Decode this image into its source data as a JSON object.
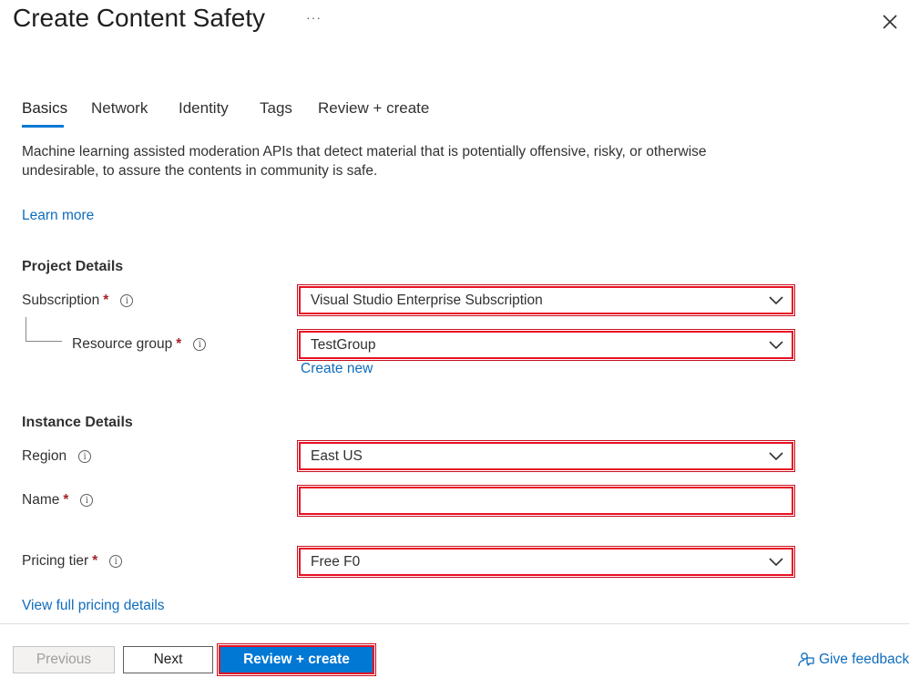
{
  "header": {
    "title": "Create Content Safety",
    "more_label": "···",
    "close_icon": "close-icon"
  },
  "tabs": [
    {
      "label": "Basics",
      "active": true
    },
    {
      "label": "Network",
      "active": false
    },
    {
      "label": "Identity",
      "active": false
    },
    {
      "label": "Tags",
      "active": false
    },
    {
      "label": "Review + create",
      "active": false
    }
  ],
  "description": "Machine learning assisted moderation APIs that detect material that is potentially offensive, risky, or otherwise undesirable, to assure the contents in community is safe.",
  "learn_more": "Learn more",
  "project_details": {
    "heading": "Project Details",
    "subscription": {
      "label": "Subscription",
      "required": "*",
      "value": "Visual Studio Enterprise Subscription"
    },
    "resource_group": {
      "label": "Resource group",
      "required": "*",
      "value": "TestGroup"
    },
    "create_new": "Create new"
  },
  "instance_details": {
    "heading": "Instance Details",
    "region": {
      "label": "Region",
      "value": "East US"
    },
    "name": {
      "label": "Name",
      "required": "*",
      "value": ""
    },
    "pricing_tier": {
      "label": "Pricing tier",
      "required": "*",
      "value": "Free F0"
    }
  },
  "pricing_link": "View full pricing details",
  "footer": {
    "previous": "Previous",
    "next": "Next",
    "review_create": "Review + create",
    "give_feedback": "Give feedback"
  },
  "colors": {
    "accent": "#0078d4",
    "link": "#0f6cbd",
    "highlight": "#e81123",
    "required": "#a4262c"
  }
}
